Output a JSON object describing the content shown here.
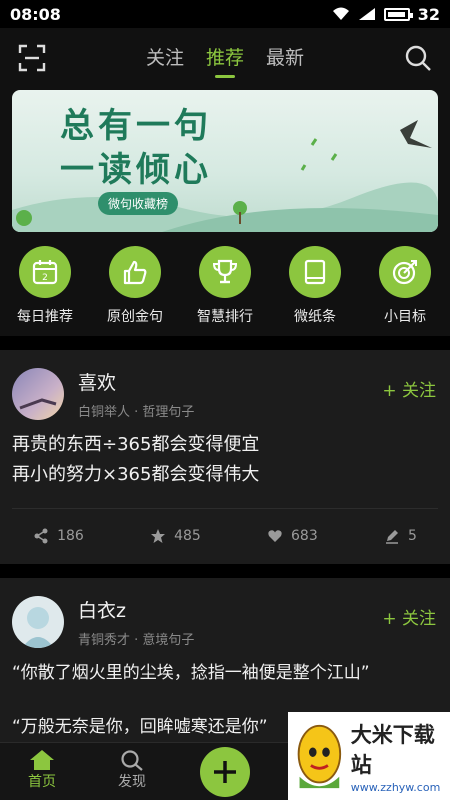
{
  "status_bar": {
    "time": "08:08",
    "battery": "32"
  },
  "nav": {
    "tabs": [
      "关注",
      "推荐",
      "最新"
    ],
    "active_tab": 1
  },
  "banner": {
    "title_line1": "总有一句",
    "title_line2": "一读倾心",
    "tag": "微句收藏榜"
  },
  "shortcuts": [
    {
      "label": "每日推荐",
      "icon": "calendar-icon",
      "badge": "2"
    },
    {
      "label": "原创金句",
      "icon": "thumbs-up-icon"
    },
    {
      "label": "智慧排行",
      "icon": "trophy-icon"
    },
    {
      "label": "微纸条",
      "icon": "book-icon"
    },
    {
      "label": "小目标",
      "icon": "target-icon"
    }
  ],
  "posts": [
    {
      "user": "喜欢",
      "meta": "白铜举人 · 哲理句子",
      "follow": "+ 关注",
      "text_line1": "再贵的东西÷365都会变得便宜",
      "text_line2": "再小的努力×365都会变得伟大",
      "shares": "186",
      "stars": "485",
      "likes": "683",
      "edits": "5"
    },
    {
      "user": "白衣z",
      "meta": "青铜秀才 · 意境句子",
      "follow": "+ 关注",
      "text_line1": "“你散了烟火里的尘埃，捻指一袖便是整个江山”",
      "text_line2": "“万般无奈是你，回眸嘘寒还是你”"
    }
  ],
  "bottom_nav": {
    "home": "首页",
    "discover": "发现"
  },
  "watermark": {
    "title": "大米下载站",
    "url": "www.zzhyw.com"
  },
  "colors": {
    "accent": "#8cc63f",
    "background": "#111111",
    "card": "#1c1c1c"
  }
}
